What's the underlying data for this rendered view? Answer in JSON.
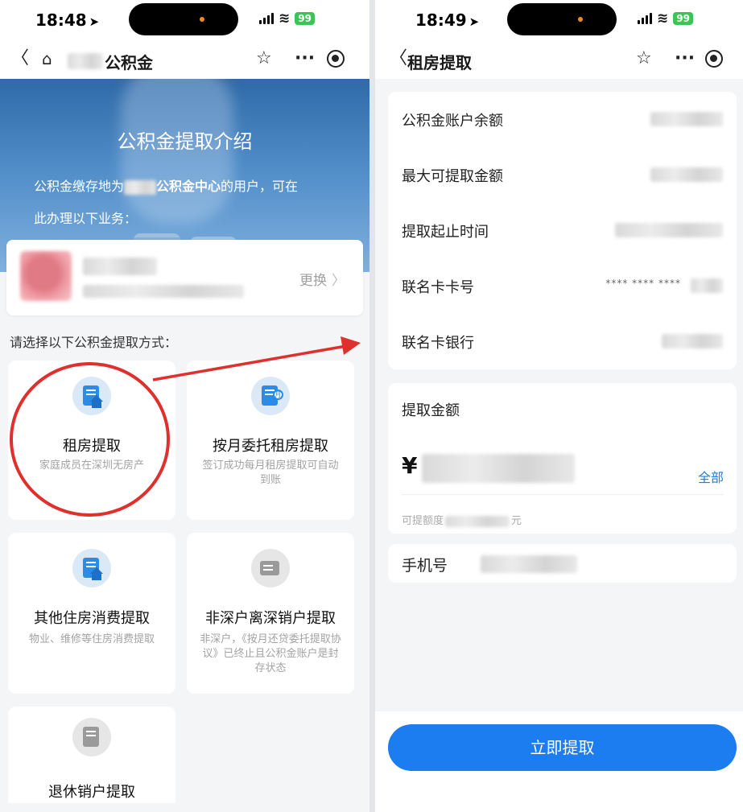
{
  "left": {
    "status": {
      "time": "18:48",
      "battery": "99"
    },
    "nav": {
      "title": "公积金"
    },
    "banner": {
      "title": "公积金提取介绍",
      "desc_prefix": "公积金缴存地为",
      "desc_highlight": "公积金中心",
      "desc_suffix": "的用户，可在",
      "desc_line2": "此办理以下业务："
    },
    "account": {
      "change_label": "更换"
    },
    "section_label": "请选择以下公积金提取方式：",
    "options": [
      {
        "title": "租房提取",
        "desc": "家庭成员在深圳无房产",
        "icon": "house-doc-icon"
      },
      {
        "title": "按月委托租房提取",
        "desc": "签订成功每月租房提取可自动到账",
        "icon": "monthly-doc-icon"
      },
      {
        "title": "其他住房消费提取",
        "desc": "物业、维修等住房消费提取",
        "icon": "house-doc-icon"
      },
      {
        "title": "非深户离深销户提取",
        "desc": "非深户，《按月还贷委托提取协议》已终止且公积金账户是封存状态",
        "icon": "card-icon"
      },
      {
        "title": "退休销户提取",
        "desc": "",
        "icon": "retire-doc-icon"
      }
    ]
  },
  "right": {
    "status": {
      "time": "18:49",
      "battery": "99"
    },
    "nav": {
      "title": "租房提取"
    },
    "info_rows": [
      {
        "label": "公积金账户余额"
      },
      {
        "label": "最大可提取金额"
      },
      {
        "label": "提取起止时间"
      },
      {
        "label": "联名卡卡号",
        "masked": "**** **** ****"
      },
      {
        "label": "联名卡银行"
      }
    ],
    "amount": {
      "label": "提取金额",
      "currency": "¥",
      "all_label": "全部",
      "hint_prefix": "可提额度",
      "hint_suffix": "元"
    },
    "phone": {
      "label": "手机号"
    },
    "submit_label": "立即提取"
  },
  "colors": {
    "accent": "#1c7df0",
    "annotation": "#e0302d"
  }
}
